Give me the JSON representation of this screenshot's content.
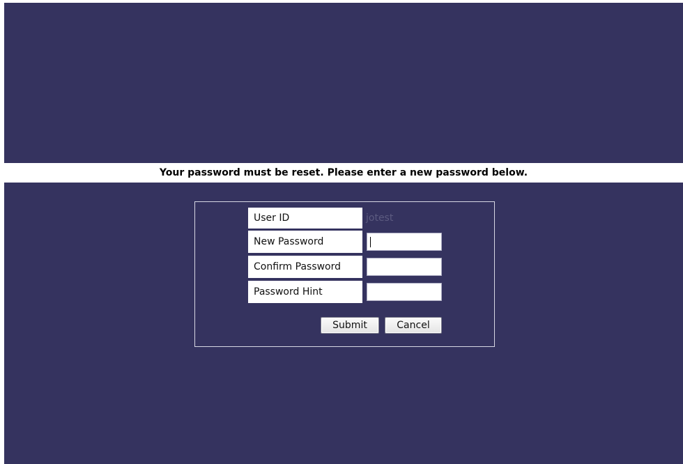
{
  "message": {
    "text": "Your password must be reset. Please enter a new password below."
  },
  "form": {
    "user_id_label": "User ID",
    "user_id_value": "jotest",
    "new_password_label": "New Password",
    "new_password_value": "",
    "confirm_password_label": "Confirm Password",
    "confirm_password_value": "",
    "password_hint_label": "Password Hint",
    "password_hint_value": "",
    "submit_label": "Submit",
    "cancel_label": "Cancel"
  },
  "colors": {
    "background": "#35335f",
    "banner": "#ffffff",
    "form_border": "#d8d8e4"
  }
}
